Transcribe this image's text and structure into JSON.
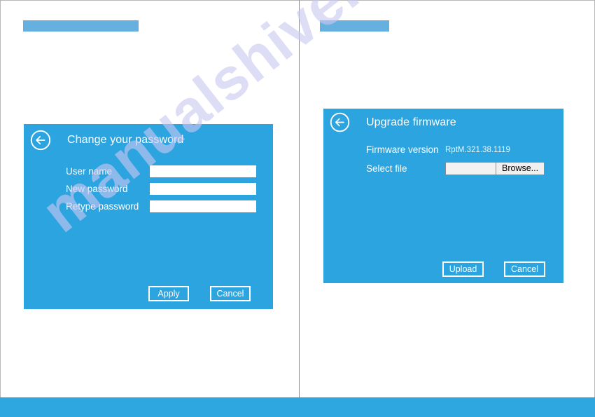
{
  "document": {
    "watermark_text": "manualshive.com",
    "footer_color": "#2ea7e0",
    "accent_color": "#2ba4e0",
    "heading_bar_color": "#66b0e0",
    "divider_color": "#8f8f8f"
  },
  "left_page": {
    "heading_bar": "",
    "dialog": {
      "back_icon": "circled-left-arrow-icon",
      "title": "Change your password",
      "fields": [
        {
          "label": "User name",
          "value": "",
          "placeholder": ""
        },
        {
          "label": "New password",
          "value": "",
          "placeholder": ""
        },
        {
          "label": "Retype password",
          "value": "",
          "placeholder": ""
        }
      ],
      "buttons": {
        "primary": "Apply",
        "secondary": "Cancel"
      }
    }
  },
  "right_page": {
    "heading_bar": "",
    "dialog": {
      "back_icon": "circled-left-arrow-icon",
      "title": "Upgrade firmware",
      "firmware_version_label": "Firmware version",
      "firmware_version_value": "RptM.321.38.1119",
      "select_file_label": "Select file",
      "select_file_value": "",
      "browse_label": "Browse...",
      "buttons": {
        "primary": "Upload",
        "secondary": "Cancel"
      }
    }
  }
}
